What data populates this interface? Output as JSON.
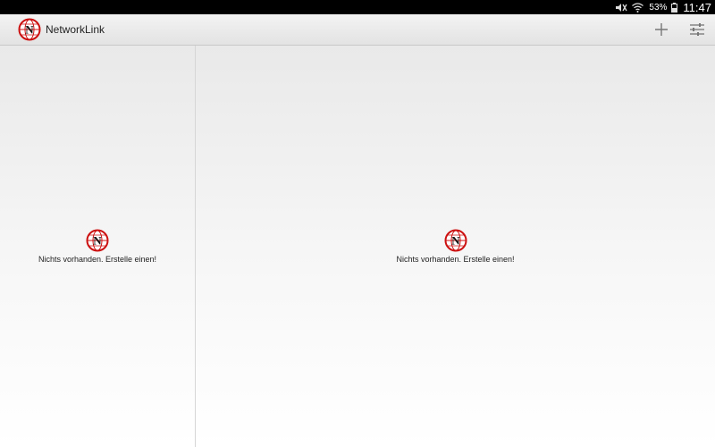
{
  "status_bar": {
    "battery_percent": "53%",
    "time": "11:47",
    "icons": [
      "mute-icon",
      "wifi-icon",
      "battery-icon"
    ]
  },
  "app_bar": {
    "logo_letter": "N",
    "title": "NetworkLink",
    "actions": [
      {
        "name": "add",
        "icon": "plus-icon"
      },
      {
        "name": "settings",
        "icon": "sliders-icon"
      }
    ]
  },
  "left_pane": {
    "empty_logo_letter": "N",
    "empty_message": "Nichts vorhanden. Erstelle einen!"
  },
  "right_pane": {
    "empty_logo_letter": "N",
    "empty_message": "Nichts vorhanden. Erstelle einen!"
  },
  "colors": {
    "logo_red": "#cc1111",
    "status_bar": "#000000",
    "action_bar": "#e8e8e8"
  }
}
